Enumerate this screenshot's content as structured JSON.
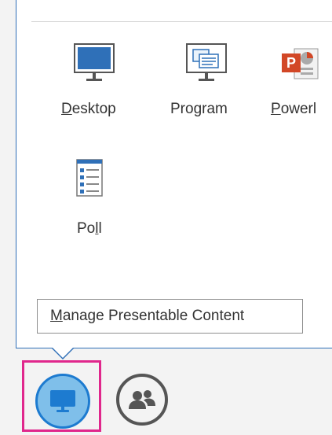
{
  "content_options": [
    {
      "id": "desktop",
      "label_parts": [
        "",
        "D",
        "esktop"
      ],
      "icon": "monitor-icon"
    },
    {
      "id": "program",
      "label_parts": [
        "Program",
        "",
        ""
      ],
      "icon": "program-window-icon"
    },
    {
      "id": "powerpoint",
      "label_parts": [
        "",
        "P",
        "owerl"
      ],
      "icon": "powerpoint-icon"
    },
    {
      "id": "poll",
      "label_parts": [
        "Po",
        "l",
        "l"
      ],
      "icon": "poll-icon"
    }
  ],
  "manage_button": {
    "label_parts": [
      "",
      "M",
      "anage Presentable Content"
    ]
  },
  "bottom_bar": {
    "present_icon": "present-monitor-icon",
    "people_icon": "participants-icon"
  },
  "colors": {
    "accent_blue": "#1d7bd0",
    "highlight_pink": "#e0278c",
    "powerpoint_orange": "#d24726"
  }
}
